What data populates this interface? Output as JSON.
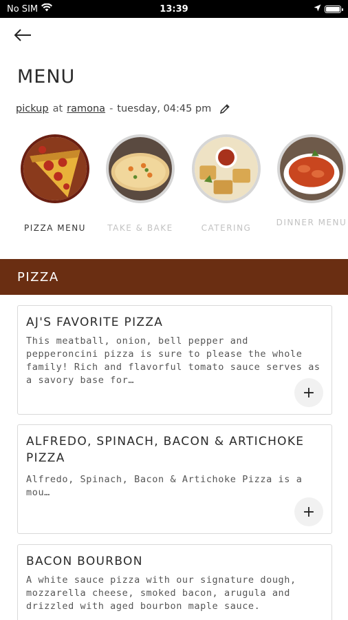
{
  "status_bar": {
    "carrier": "No SIM",
    "time": "13:39"
  },
  "header": {
    "title": "MENU"
  },
  "order": {
    "method": "pickup",
    "at_word": "at",
    "location": "ramona",
    "separator": "-",
    "schedule": "tuesday, 04:45 pm"
  },
  "categories": [
    {
      "label": "PIZZA MENU",
      "active": true
    },
    {
      "label": "TAKE & BAKE",
      "active": false
    },
    {
      "label": "CATERING",
      "active": false
    },
    {
      "label": "DINNER MENU",
      "active": false
    }
  ],
  "section": {
    "title": "PIZZA"
  },
  "items": [
    {
      "name": "AJ'S FAVORITE PIZZA",
      "description": "This meatball, onion, bell pepper and pepperoncini pizza is sure to please the whole family! Rich and flavorful tomato sauce serves as a savory base for…",
      "add_label": "+"
    },
    {
      "name": "ALFREDO, SPINACH, BACON & ARTICHOKE PIZZA",
      "description": "Alfredo, Spinach, Bacon & Artichoke Pizza is a mou…",
      "add_label": "+"
    },
    {
      "name": "BACON BOURBON",
      "description": "A white sauce pizza with our signature dough, mozzarella cheese, smoked bacon, arugula and drizzled with aged bourbon maple sauce.",
      "add_label": "+"
    }
  ],
  "colors": {
    "accent": "#6a2e12",
    "active_ring": "#6a1f12",
    "inactive_ring": "#d6d6d6"
  },
  "icons": {
    "back": "arrow-left-icon",
    "edit": "pencil-icon",
    "add": "plus-icon",
    "wifi": "wifi-icon",
    "location": "location-arrow-icon",
    "battery": "battery-icon"
  }
}
